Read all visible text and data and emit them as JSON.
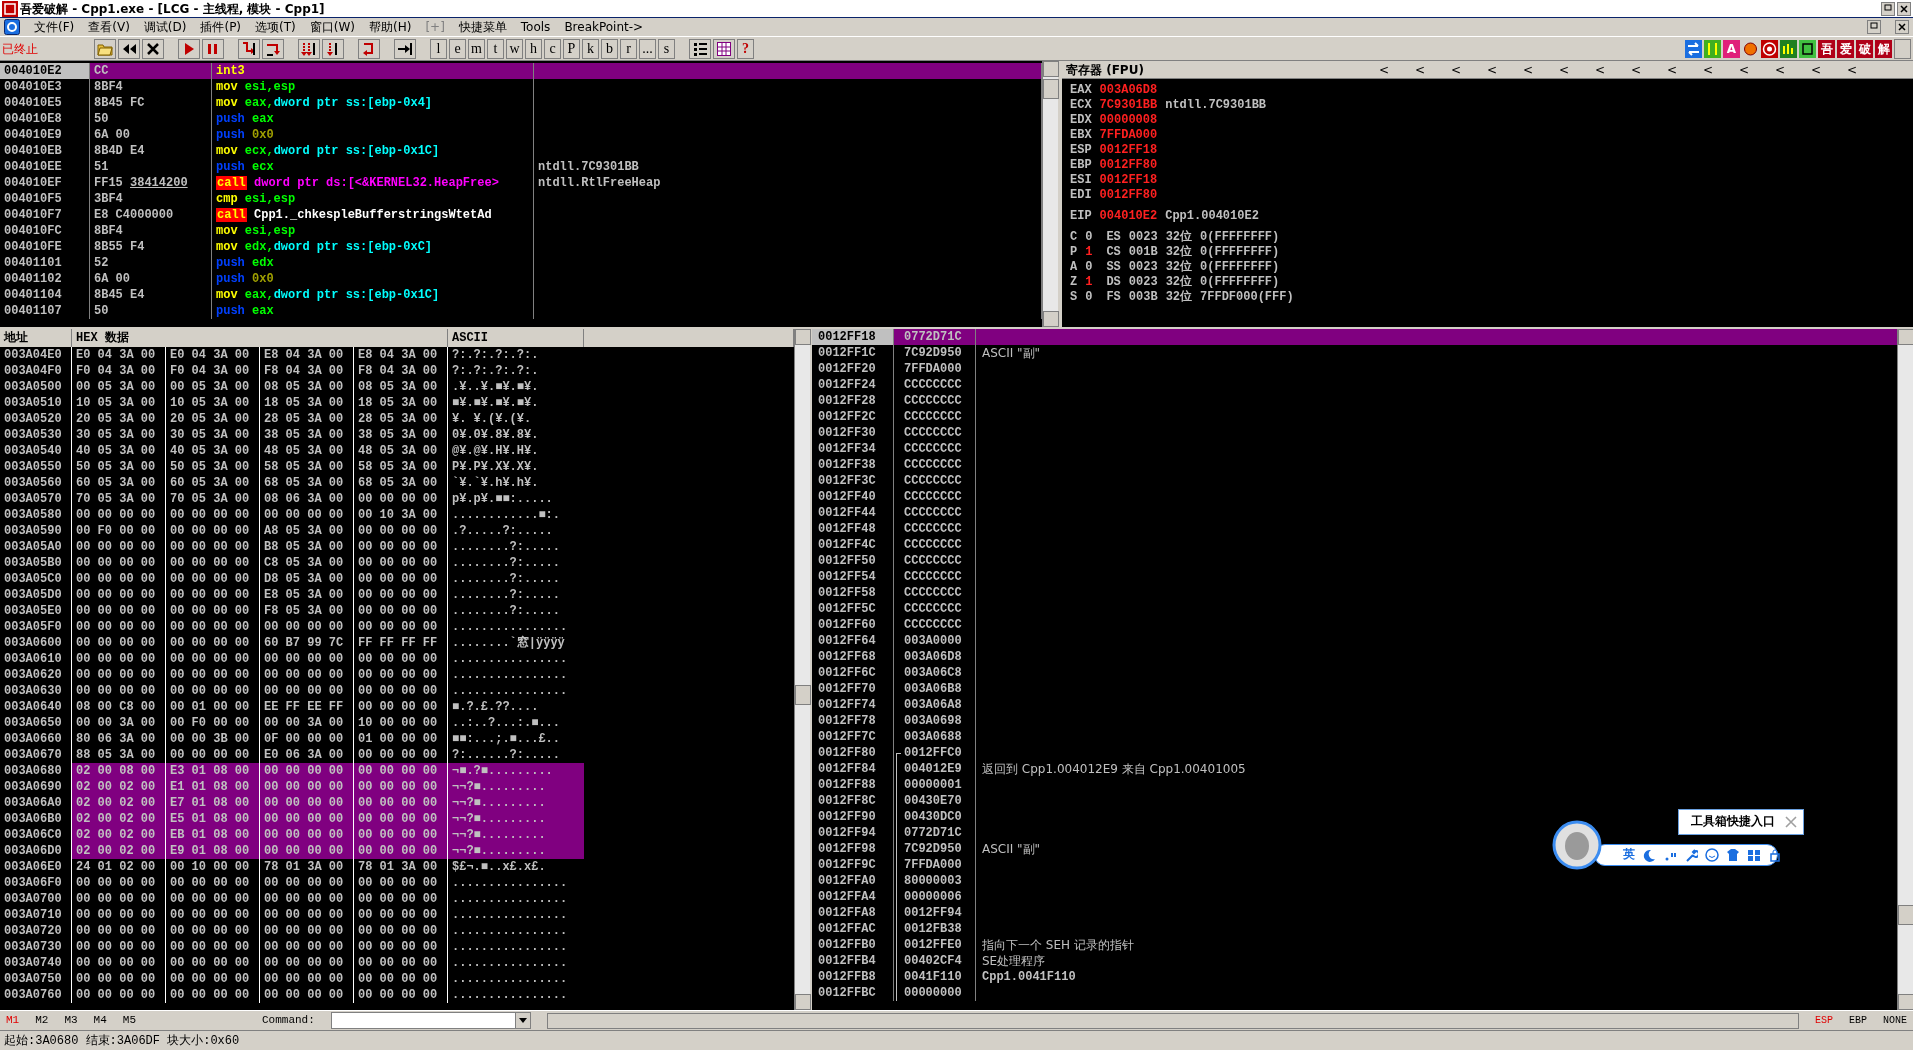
{
  "window": {
    "title": "吾爱破解 - Cpp1.exe - [LCG -  主线程, 模块 - Cpp1]"
  },
  "menu": [
    {
      "label": "文件(F)",
      "disabled": false
    },
    {
      "label": "查看(V)",
      "disabled": false
    },
    {
      "label": "调试(D)",
      "disabled": false
    },
    {
      "label": "插件(P)",
      "disabled": false
    },
    {
      "label": "选项(T)",
      "disabled": false
    },
    {
      "label": "窗口(W)",
      "disabled": false
    },
    {
      "label": "帮助(H)",
      "disabled": false
    },
    {
      "label": "[+]",
      "disabled": true
    },
    {
      "label": "快捷菜单",
      "disabled": false
    },
    {
      "label": "Tools",
      "disabled": false
    },
    {
      "label": "BreakPoint->",
      "disabled": false
    }
  ],
  "toolbar": {
    "status": "已终止",
    "letter_buttons": [
      "l",
      "e",
      "m",
      "t",
      "w",
      "h",
      "c",
      "P",
      "k",
      "b",
      "r",
      "...",
      "s"
    ],
    "help": "?",
    "plugin_buttons": [
      "A",
      "吾",
      "爱",
      "破",
      "解"
    ]
  },
  "disassembly": {
    "rows": [
      {
        "address": "004010E2",
        "hex": "CC",
        "mnemonic": "int3",
        "kind": "interrupt",
        "operands": [],
        "selected": true
      },
      {
        "address": "004010E3",
        "hex": "8BF4",
        "mnemonic": "mov",
        "kind": "move",
        "operands": [
          {
            "text": "esi,esp",
            "kind": "reg"
          }
        ],
        "selected": false
      },
      {
        "address": "004010E5",
        "hex": "8B45 FC",
        "mnemonic": "mov",
        "kind": "move",
        "operands": [
          {
            "text": "eax,",
            "kind": "reg"
          },
          {
            "text": "dword ptr ss:[ebp-0x4]",
            "kind": "mem"
          }
        ],
        "selected": false
      },
      {
        "address": "004010E8",
        "hex": "50",
        "mnemonic": "push",
        "kind": "stack",
        "operands": [
          {
            "text": "eax",
            "kind": "reg"
          }
        ],
        "selected": false
      },
      {
        "address": "004010E9",
        "hex": "6A 00",
        "mnemonic": "push",
        "kind": "stack",
        "operands": [
          {
            "text": "0x0",
            "kind": "imm"
          }
        ],
        "selected": false
      },
      {
        "address": "004010EB",
        "hex": "8B4D E4",
        "mnemonic": "mov",
        "kind": "move",
        "operands": [
          {
            "text": "ecx,",
            "kind": "reg"
          },
          {
            "text": "dword ptr ss:[ebp-0x1C]",
            "kind": "mem"
          }
        ],
        "selected": false
      },
      {
        "address": "004010EE",
        "hex": "51",
        "mnemonic": "push",
        "kind": "stack",
        "operands": [
          {
            "text": "ecx",
            "kind": "reg"
          }
        ],
        "comment": "ntdll.7C9301BB",
        "selected": false
      },
      {
        "address": "004010EF",
        "hex": "FF15",
        "hex_fixup": "38414200",
        "mnemonic": "call",
        "kind": "call",
        "operands": [
          {
            "text": "dword ptr ds:[<&KERNEL32.HeapFree>",
            "kind": "api"
          }
        ],
        "comment": "ntdll.RtlFreeHeap",
        "selected": false
      },
      {
        "address": "004010F5",
        "hex": "3BF4",
        "mnemonic": "cmp",
        "kind": "compare",
        "operands": [
          {
            "text": "esi,esp",
            "kind": "reg"
          }
        ],
        "selected": false
      },
      {
        "address": "004010F7",
        "hex": "E8 C4000000",
        "mnemonic": "call",
        "kind": "call",
        "operands": [
          {
            "text": "Cpp1._chkespleBufferstringsWtetAd",
            "kind": "sym"
          }
        ],
        "selected": false
      },
      {
        "address": "004010FC",
        "hex": "8BF4",
        "mnemonic": "mov",
        "kind": "move",
        "operands": [
          {
            "text": "esi,esp",
            "kind": "reg"
          }
        ],
        "selected": false
      },
      {
        "address": "004010FE",
        "hex": "8B55 F4",
        "mnemonic": "mov",
        "kind": "move",
        "operands": [
          {
            "text": "edx,",
            "kind": "reg"
          },
          {
            "text": "dword ptr ss:[ebp-0xC]",
            "kind": "mem"
          }
        ],
        "selected": false
      },
      {
        "address": "00401101",
        "hex": "52",
        "mnemonic": "push",
        "kind": "stack",
        "operands": [
          {
            "text": "edx",
            "kind": "reg"
          }
        ],
        "selected": false
      },
      {
        "address": "00401102",
        "hex": "6A 00",
        "mnemonic": "push",
        "kind": "stack",
        "operands": [
          {
            "text": "0x0",
            "kind": "imm"
          }
        ],
        "selected": false
      },
      {
        "address": "00401104",
        "hex": "8B45 E4",
        "mnemonic": "mov",
        "kind": "move",
        "operands": [
          {
            "text": "eax,",
            "kind": "reg"
          },
          {
            "text": "dword ptr ss:[ebp-0x1C]",
            "kind": "mem"
          }
        ],
        "selected": false
      },
      {
        "address": "00401107",
        "hex": "50",
        "mnemonic": "push",
        "kind": "stack",
        "operands": [
          {
            "text": "eax",
            "kind": "reg"
          }
        ],
        "selected": false
      }
    ]
  },
  "registers": {
    "title": "寄存器 (FPU)",
    "arrows": [
      "<",
      "<",
      "<",
      "<",
      "<",
      "<",
      "<",
      "<",
      "<",
      "<",
      "<",
      "<",
      "<",
      "<"
    ],
    "general": [
      {
        "name": "EAX",
        "value": "003A06D8",
        "changed": true
      },
      {
        "name": "ECX",
        "value": "7C9301BB",
        "changed": true,
        "comment": "ntdll.7C9301BB"
      },
      {
        "name": "EDX",
        "value": "00000008",
        "changed": true
      },
      {
        "name": "EBX",
        "value": "7FFDA000",
        "changed": true
      },
      {
        "name": "ESP",
        "value": "0012FF18",
        "changed": true
      },
      {
        "name": "EBP",
        "value": "0012FF80",
        "changed": true
      },
      {
        "name": "ESI",
        "value": "0012FF18",
        "changed": true
      },
      {
        "name": "EDI",
        "value": "0012FF80",
        "changed": true
      }
    ],
    "eip": {
      "name": "EIP",
      "value": "004010E2",
      "changed": true,
      "comment": "Cpp1.004010E2"
    },
    "flags": [
      {
        "flag": "C",
        "value": "0",
        "changed": false,
        "segment": "ES",
        "selector": "0023",
        "bits": "32位",
        "base": "0(FFFFFFFF)"
      },
      {
        "flag": "P",
        "value": "1",
        "changed": true,
        "segment": "CS",
        "selector": "001B",
        "bits": "32位",
        "base": "0(FFFFFFFF)"
      },
      {
        "flag": "A",
        "value": "0",
        "changed": false,
        "segment": "SS",
        "selector": "0023",
        "bits": "32位",
        "base": "0(FFFFFFFF)"
      },
      {
        "flag": "Z",
        "value": "1",
        "changed": true,
        "segment": "DS",
        "selector": "0023",
        "bits": "32位",
        "base": "0(FFFFFFFF)"
      },
      {
        "flag": "S",
        "value": "0",
        "changed": false,
        "segment": "FS",
        "selector": "003B",
        "bits": "32位",
        "base": "7FFDF000(FFF)"
      }
    ]
  },
  "dump": {
    "columns": [
      "地址",
      "HEX 数据",
      "ASCII"
    ],
    "rows": [
      {
        "address": "003A04E0",
        "bytes": "E0 04 3A 00 E0 04 3A 00 E8 04 3A 00 E8 04 3A 00",
        "ascii": "?:.?:.?:.?:.",
        "selected": false
      },
      {
        "address": "003A04F0",
        "bytes": "F0 04 3A 00 F0 04 3A 00 F8 04 3A 00 F8 04 3A 00",
        "ascii": "?:.?:.?:.?:.",
        "selected": false
      },
      {
        "address": "003A0500",
        "bytes": "00 05 3A 00 00 05 3A 00 08 05 3A 00 08 05 3A 00",
        "ascii": ".¥..¥.■¥.■¥.",
        "selected": false
      },
      {
        "address": "003A0510",
        "bytes": "10 05 3A 00 10 05 3A 00 18 05 3A 00 18 05 3A 00",
        "ascii": "■¥.■¥.■¥.■¥.",
        "selected": false
      },
      {
        "address": "003A0520",
        "bytes": "20 05 3A 00 20 05 3A 00 28 05 3A 00 28 05 3A 00",
        "ascii": " ¥. ¥.(¥.(¥.",
        "selected": false
      },
      {
        "address": "003A0530",
        "bytes": "30 05 3A 00 30 05 3A 00 38 05 3A 00 38 05 3A 00",
        "ascii": "0¥.0¥.8¥.8¥.",
        "selected": false
      },
      {
        "address": "003A0540",
        "bytes": "40 05 3A 00 40 05 3A 00 48 05 3A 00 48 05 3A 00",
        "ascii": "@¥.@¥.H¥.H¥.",
        "selected": false
      },
      {
        "address": "003A0550",
        "bytes": "50 05 3A 00 50 05 3A 00 58 05 3A 00 58 05 3A 00",
        "ascii": "P¥.P¥.X¥.X¥.",
        "selected": false
      },
      {
        "address": "003A0560",
        "bytes": "60 05 3A 00 60 05 3A 00 68 05 3A 00 68 05 3A 00",
        "ascii": "`¥.`¥.h¥.h¥.",
        "selected": false
      },
      {
        "address": "003A0570",
        "bytes": "70 05 3A 00 70 05 3A 00 08 06 3A 00 00 00 00 00",
        "ascii": "p¥.p¥.■■:.....",
        "selected": false
      },
      {
        "address": "003A0580",
        "bytes": "00 00 00 00 00 00 00 00 00 00 00 00 00 10 3A 00",
        "ascii": "............■:.",
        "selected": false
      },
      {
        "address": "003A0590",
        "bytes": "00 F0 00 00 00 00 00 00 A8 05 3A 00 00 00 00 00",
        "ascii": ".?.....?:.....",
        "selected": false
      },
      {
        "address": "003A05A0",
        "bytes": "00 00 00 00 00 00 00 00 B8 05 3A 00 00 00 00 00",
        "ascii": "........?:.....",
        "selected": false
      },
      {
        "address": "003A05B0",
        "bytes": "00 00 00 00 00 00 00 00 C8 05 3A 00 00 00 00 00",
        "ascii": "........?:.....",
        "selected": false
      },
      {
        "address": "003A05C0",
        "bytes": "00 00 00 00 00 00 00 00 D8 05 3A 00 00 00 00 00",
        "ascii": "........?:.....",
        "selected": false
      },
      {
        "address": "003A05D0",
        "bytes": "00 00 00 00 00 00 00 00 E8 05 3A 00 00 00 00 00",
        "ascii": "........?:.....",
        "selected": false
      },
      {
        "address": "003A05E0",
        "bytes": "00 00 00 00 00 00 00 00 F8 05 3A 00 00 00 00 00",
        "ascii": "........?:.....",
        "selected": false
      },
      {
        "address": "003A05F0",
        "bytes": "00 00 00 00 00 00 00 00 00 00 00 00 00 00 00 00",
        "ascii": "................",
        "selected": false
      },
      {
        "address": "003A0600",
        "bytes": "00 00 00 00 00 00 00 00 60 B7 99 7C FF FF FF FF",
        "ascii": "........`窓|ÿÿÿÿ",
        "selected": false
      },
      {
        "address": "003A0610",
        "bytes": "00 00 00 00 00 00 00 00 00 00 00 00 00 00 00 00",
        "ascii": "................",
        "selected": false
      },
      {
        "address": "003A0620",
        "bytes": "00 00 00 00 00 00 00 00 00 00 00 00 00 00 00 00",
        "ascii": "................",
        "selected": false
      },
      {
        "address": "003A0630",
        "bytes": "00 00 00 00 00 00 00 00 00 00 00 00 00 00 00 00",
        "ascii": "................",
        "selected": false
      },
      {
        "address": "003A0640",
        "bytes": "08 00 C8 00 00 01 00 00 EE FF EE FF 00 00 00 00",
        "ascii": "■.?.£.??....",
        "selected": false
      },
      {
        "address": "003A0650",
        "bytes": "00 00 3A 00 00 F0 00 00 00 00 3A 00 10 00 00 00",
        "ascii": "..:..?...:.■...",
        "selected": false
      },
      {
        "address": "003A0660",
        "bytes": "80 06 3A 00 00 00 3B 00 0F 00 00 00 01 00 00 00",
        "ascii": "■■:...;.■...£..",
        "selected": false
      },
      {
        "address": "003A0670",
        "bytes": "88 05 3A 00 00 00 00 00 E0 06 3A 00 00 00 00 00",
        "ascii": "?:......?:.....",
        "selected": false
      },
      {
        "address": "003A0680",
        "bytes": "02 00 08 00 E3 01 08 00 00 00 00 00 00 00 00 00",
        "ascii": "¬■.?■.........",
        "selected": true
      },
      {
        "address": "003A0690",
        "bytes": "02 00 02 00 E1 01 08 00 00 00 00 00 00 00 00 00",
        "ascii": "¬¬?■.........",
        "selected": true
      },
      {
        "address": "003A06A0",
        "bytes": "02 00 02 00 E7 01 08 00 00 00 00 00 00 00 00 00",
        "ascii": "¬¬?■.........",
        "selected": true
      },
      {
        "address": "003A06B0",
        "bytes": "02 00 02 00 E5 01 08 00 00 00 00 00 00 00 00 00",
        "ascii": "¬¬?■.........",
        "selected": true
      },
      {
        "address": "003A06C0",
        "bytes": "02 00 02 00 EB 01 08 00 00 00 00 00 00 00 00 00",
        "ascii": "¬¬?■.........",
        "selected": true
      },
      {
        "address": "003A06D0",
        "bytes": "02 00 02 00 E9 01 08 00 00 00 00 00 00 00 00 00",
        "ascii": "¬¬?■.........",
        "selected": true
      },
      {
        "address": "003A06E0",
        "bytes": "24 01 02 00 00 10 00 00 78 01 3A 00 78 01 3A 00",
        "ascii": "$£¬.■..x£.x£.",
        "selected": false
      },
      {
        "address": "003A06F0",
        "bytes": "00 00 00 00 00 00 00 00 00 00 00 00 00 00 00 00",
        "ascii": "................",
        "selected": false
      },
      {
        "address": "003A0700",
        "bytes": "00 00 00 00 00 00 00 00 00 00 00 00 00 00 00 00",
        "ascii": "................",
        "selected": false
      },
      {
        "address": "003A0710",
        "bytes": "00 00 00 00 00 00 00 00 00 00 00 00 00 00 00 00",
        "ascii": "................",
        "selected": false
      },
      {
        "address": "003A0720",
        "bytes": "00 00 00 00 00 00 00 00 00 00 00 00 00 00 00 00",
        "ascii": "................",
        "selected": false
      },
      {
        "address": "003A0730",
        "bytes": "00 00 00 00 00 00 00 00 00 00 00 00 00 00 00 00",
        "ascii": "................",
        "selected": false
      },
      {
        "address": "003A0740",
        "bytes": "00 00 00 00 00 00 00 00 00 00 00 00 00 00 00 00",
        "ascii": "................",
        "selected": false
      },
      {
        "address": "003A0750",
        "bytes": "00 00 00 00 00 00 00 00 00 00 00 00 00 00 00 00",
        "ascii": "................",
        "selected": false
      },
      {
        "address": "003A0760",
        "bytes": "00 00 00 00 00 00 00 00 00 00 00 00 00 00 00 00",
        "ascii": "................",
        "selected": false
      }
    ]
  },
  "stack": {
    "rows": [
      {
        "address": "0012FF18",
        "value": "0772D71C",
        "in_frame": false,
        "selected": true
      },
      {
        "address": "0012FF1C",
        "value": "7C92D950",
        "in_frame": false,
        "comment": "ASCII \"副\"",
        "selected": false
      },
      {
        "address": "0012FF20",
        "value": "7FFDA000",
        "in_frame": false,
        "selected": false
      },
      {
        "address": "0012FF24",
        "value": "CCCCCCCC",
        "in_frame": false,
        "selected": false
      },
      {
        "address": "0012FF28",
        "value": "CCCCCCCC",
        "in_frame": false,
        "selected": false
      },
      {
        "address": "0012FF2C",
        "value": "CCCCCCCC",
        "in_frame": false,
        "selected": false
      },
      {
        "address": "0012FF30",
        "value": "CCCCCCCC",
        "in_frame": false,
        "selected": false
      },
      {
        "address": "0012FF34",
        "value": "CCCCCCCC",
        "in_frame": false,
        "selected": false
      },
      {
        "address": "0012FF38",
        "value": "CCCCCCCC",
        "in_frame": false,
        "selected": false
      },
      {
        "address": "0012FF3C",
        "value": "CCCCCCCC",
        "in_frame": false,
        "selected": false
      },
      {
        "address": "0012FF40",
        "value": "CCCCCCCC",
        "in_frame": false,
        "selected": false
      },
      {
        "address": "0012FF44",
        "value": "CCCCCCCC",
        "in_frame": false,
        "selected": false
      },
      {
        "address": "0012FF48",
        "value": "CCCCCCCC",
        "in_frame": false,
        "selected": false
      },
      {
        "address": "0012FF4C",
        "value": "CCCCCCCC",
        "in_frame": false,
        "selected": false
      },
      {
        "address": "0012FF50",
        "value": "CCCCCCCC",
        "in_frame": false,
        "selected": false
      },
      {
        "address": "0012FF54",
        "value": "CCCCCCCC",
        "in_frame": false,
        "selected": false
      },
      {
        "address": "0012FF58",
        "value": "CCCCCCCC",
        "in_frame": false,
        "selected": false
      },
      {
        "address": "0012FF5C",
        "value": "CCCCCCCC",
        "in_frame": false,
        "selected": false
      },
      {
        "address": "0012FF60",
        "value": "CCCCCCCC",
        "in_frame": false,
        "selected": false
      },
      {
        "address": "0012FF64",
        "value": "003A0000",
        "in_frame": false,
        "selected": false
      },
      {
        "address": "0012FF68",
        "value": "003A06D8",
        "in_frame": false,
        "selected": false
      },
      {
        "address": "0012FF6C",
        "value": "003A06C8",
        "in_frame": false,
        "selected": false
      },
      {
        "address": "0012FF70",
        "value": "003A06B8",
        "in_frame": false,
        "selected": false
      },
      {
        "address": "0012FF74",
        "value": "003A06A8",
        "in_frame": false,
        "selected": false
      },
      {
        "address": "0012FF78",
        "value": "003A0698",
        "in_frame": false,
        "selected": false
      },
      {
        "address": "0012FF7C",
        "value": "003A0688",
        "in_frame": false,
        "selected": false
      },
      {
        "address": "0012FF80",
        "value": "0012FFC0",
        "in_frame": true,
        "selected": false
      },
      {
        "address": "0012FF84",
        "value": "004012E9",
        "in_frame": true,
        "comment": "返回到 Cpp1.004012E9 来自 Cpp1.00401005",
        "selected": false
      },
      {
        "address": "0012FF88",
        "value": "00000001",
        "in_frame": true,
        "selected": false
      },
      {
        "address": "0012FF8C",
        "value": "00430E70",
        "in_frame": true,
        "selected": false
      },
      {
        "address": "0012FF90",
        "value": "00430DC0",
        "in_frame": true,
        "selected": false
      },
      {
        "address": "0012FF94",
        "value": "0772D71C",
        "in_frame": true,
        "selected": false
      },
      {
        "address": "0012FF98",
        "value": "7C92D950",
        "in_frame": true,
        "comment": "ASCII \"副\"",
        "selected": false
      },
      {
        "address": "0012FF9C",
        "value": "7FFDA000",
        "in_frame": true,
        "selected": false
      },
      {
        "address": "0012FFA0",
        "value": "80000003",
        "in_frame": true,
        "selected": false
      },
      {
        "address": "0012FFA4",
        "value": "00000006",
        "in_frame": true,
        "selected": false
      },
      {
        "address": "0012FFA8",
        "value": "0012FF94",
        "in_frame": true,
        "selected": false
      },
      {
        "address": "0012FFAC",
        "value": "0012FB38",
        "in_frame": true,
        "selected": false
      },
      {
        "address": "0012FFB0",
        "value": "0012FFE0",
        "in_frame": true,
        "comment": "指向下一个 SEH 记录的指针",
        "selected": false
      },
      {
        "address": "0012FFB4",
        "value": "00402CF4",
        "in_frame": true,
        "comment": "SE处理程序",
        "selected": false
      },
      {
        "address": "0012FFB8",
        "value": "0041F110",
        "in_frame": true,
        "comment": "Cpp1.0041F110",
        "selected": false
      },
      {
        "address": "0012FFBC",
        "value": "00000000",
        "in_frame": true,
        "selected": false
      }
    ]
  },
  "input_widget": {
    "tooltip": "工具箱快捷入口",
    "language": "英"
  },
  "bottom": {
    "memory_tabs": [
      {
        "label": "M1",
        "selected": true
      },
      {
        "label": "M2",
        "selected": false
      },
      {
        "label": "M3",
        "selected": false
      },
      {
        "label": "M4",
        "selected": false
      },
      {
        "label": "M5",
        "selected": false
      }
    ],
    "command_label": "Command:",
    "register_modes": [
      {
        "label": "ESP",
        "selected": true
      },
      {
        "label": "EBP",
        "selected": false
      },
      {
        "label": "NONE",
        "selected": false
      }
    ]
  },
  "status_bar": "起始:3A0680 结束:3A06DF 块大小:0x60"
}
